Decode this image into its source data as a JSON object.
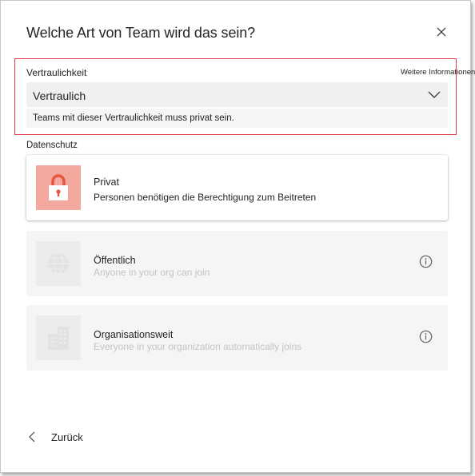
{
  "dialog": {
    "title": "Welche Art von Team wird das sein?",
    "close_icon": "close-icon"
  },
  "confidentiality": {
    "label": "Vertraulichkeit",
    "more_info_link": "Weitere Informationen",
    "selected_value": "Vertraulich",
    "hint": "Teams mit dieser Vertraulichkeit muss privat sein.",
    "highlight_color": "#e5404e"
  },
  "privacy": {
    "label": "Datenschutz",
    "options": [
      {
        "title": "Privat",
        "description": "Personen benötigen die Berechtigung zum Beitreten",
        "icon": "lock-icon",
        "state": "enabled"
      },
      {
        "title": "Öffentlich",
        "description": "Anyone in your org can join",
        "icon": "globe-icon",
        "state": "disabled"
      },
      {
        "title": "Organisationsweit",
        "description": "Everyone in your organization automatically joins",
        "icon": "building-icon",
        "state": "disabled"
      }
    ]
  },
  "footer": {
    "back_label": "Zurück"
  },
  "colors": {
    "accent_lock_bg": "#f4a99e",
    "disabled_card_bg": "#f5f5f5",
    "select_bg": "#f0f0f0"
  }
}
